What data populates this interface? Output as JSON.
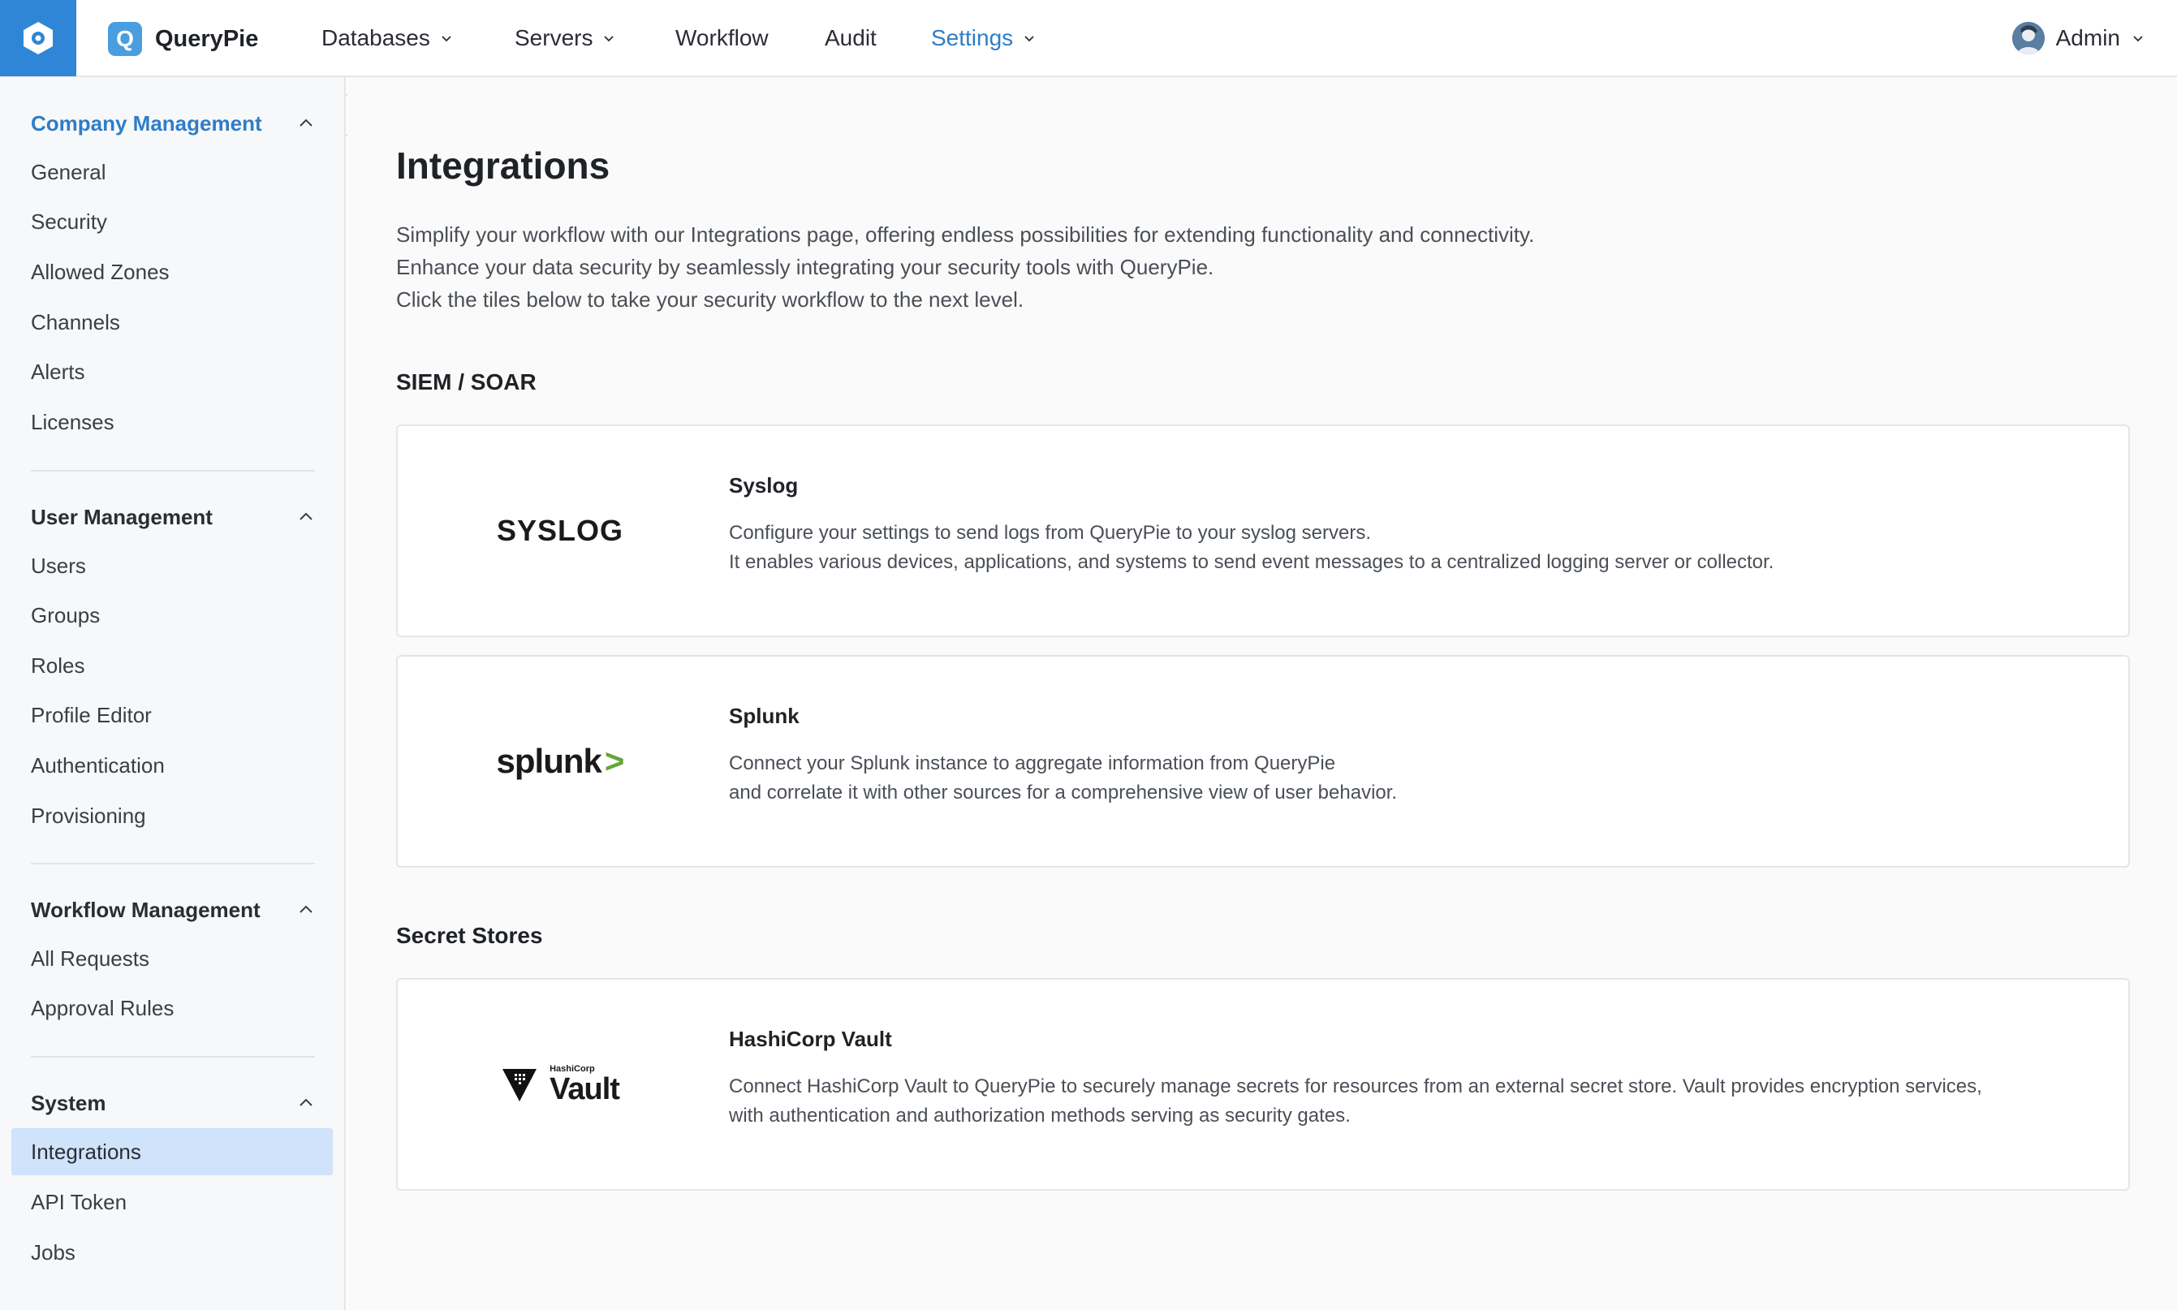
{
  "topbar": {
    "app_name": "QueryPie",
    "nav": [
      {
        "label": "Databases",
        "has_dropdown": true,
        "active": false
      },
      {
        "label": "Servers",
        "has_dropdown": true,
        "active": false
      },
      {
        "label": "Workflow",
        "has_dropdown": false,
        "active": false
      },
      {
        "label": "Audit",
        "has_dropdown": false,
        "active": false
      },
      {
        "label": "Settings",
        "has_dropdown": true,
        "active": true
      }
    ],
    "user": {
      "name": "Admin"
    },
    "colors": {
      "brand": "#2f86d6",
      "active": "#2f7dc6"
    }
  },
  "sidebar": {
    "groups": [
      {
        "title": "Company Management",
        "active": true,
        "items": [
          "General",
          "Security",
          "Allowed Zones",
          "Channels",
          "Alerts",
          "Licenses"
        ]
      },
      {
        "title": "User Management",
        "active": false,
        "items": [
          "Users",
          "Groups",
          "Roles",
          "Profile Editor",
          "Authentication",
          "Provisioning"
        ]
      },
      {
        "title": "Workflow Management",
        "active": false,
        "items": [
          "All Requests",
          "Approval Rules"
        ]
      },
      {
        "title": "System",
        "active": false,
        "items": [
          "Integrations",
          "API Token",
          "Jobs"
        ]
      }
    ],
    "selected_item": "Integrations"
  },
  "main": {
    "title": "Integrations",
    "description": [
      "Simplify your workflow with our Integrations page, offering endless possibilities for extending functionality and connectivity.",
      "Enhance your data security by seamlessly integrating your security tools with QueryPie.",
      "Click the tiles below to take your security workflow to the next level."
    ],
    "sections": [
      {
        "title": "SIEM / SOAR",
        "cards": [
          {
            "name": "Syslog",
            "logo_text": "SYSLOG",
            "lines": [
              "Configure your settings to send logs from QueryPie to your syslog servers.",
              "It enables various devices, applications, and systems to send event messages to a centralized logging server or collector."
            ]
          },
          {
            "name": "Splunk",
            "logo_text": "splunk",
            "logo_mark": ">",
            "lines": [
              "Connect your Splunk instance to aggregate information from QueryPie",
              "and correlate it with other sources for a comprehensive view of user behavior."
            ]
          }
        ]
      },
      {
        "title": "Secret Stores",
        "cards": [
          {
            "name": "HashiCorp Vault",
            "logo_small": "HashiCorp",
            "logo_big": "Vault",
            "lines": [
              "Connect HashiCorp Vault to QueryPie to securely manage secrets for resources from an external secret store. Vault provides encryption services,",
              "with authentication and authorization methods serving as security gates."
            ]
          }
        ]
      }
    ]
  }
}
